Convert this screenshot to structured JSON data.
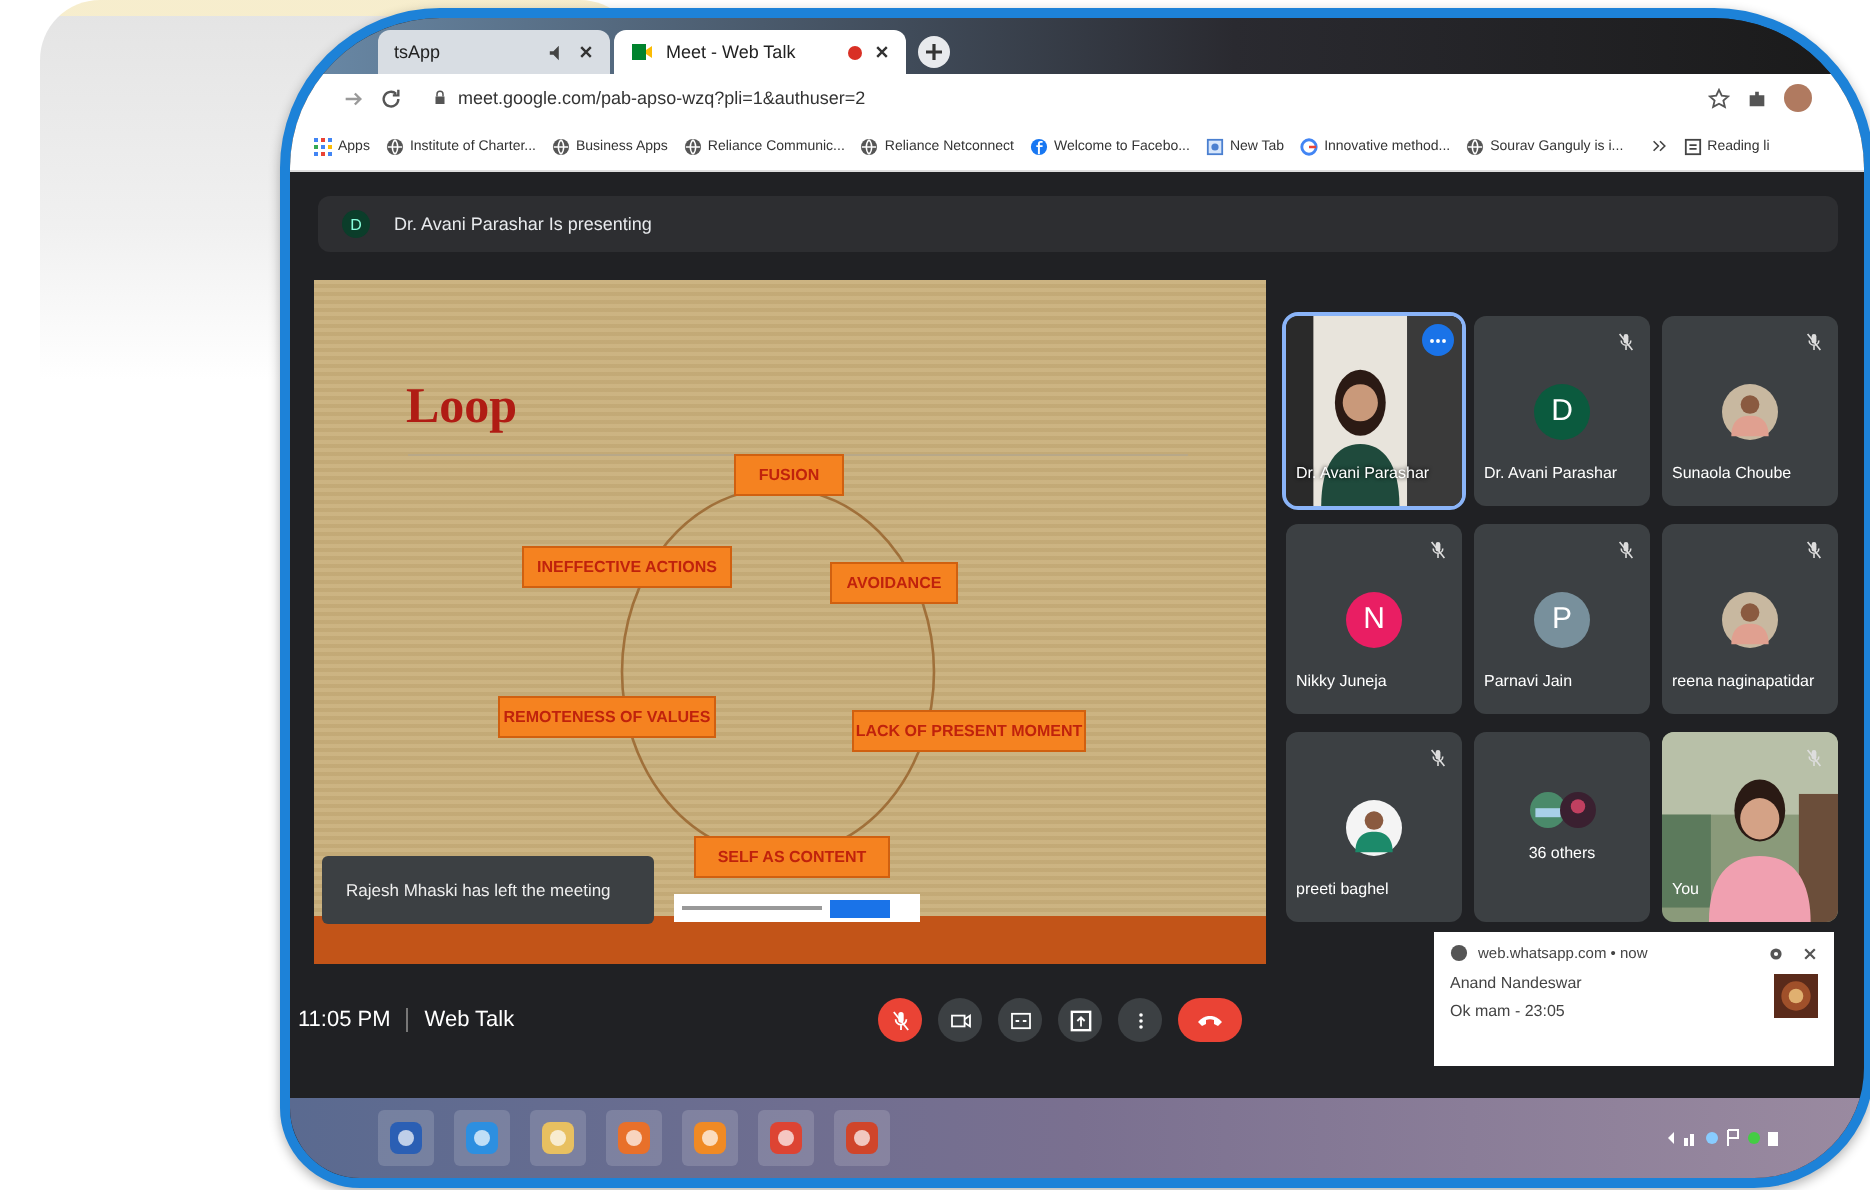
{
  "browser": {
    "tabs": [
      {
        "title": "tsApp",
        "selected": false
      },
      {
        "title": "Meet - Web Talk",
        "selected": true
      }
    ],
    "url": "meet.google.com/pab-apso-wzq?pli=1&authuser=2",
    "bookmarks": [
      {
        "label": "Apps",
        "kind": "apps"
      },
      {
        "label": "Institute of Charter...",
        "kind": "globe"
      },
      {
        "label": "Business Apps",
        "kind": "globe"
      },
      {
        "label": "Reliance Communic...",
        "kind": "globe"
      },
      {
        "label": "Reliance Netconnect",
        "kind": "globe"
      },
      {
        "label": "Welcome to Facebo...",
        "kind": "facebook"
      },
      {
        "label": "New Tab",
        "kind": "page"
      },
      {
        "label": "Innovative method...",
        "kind": "google"
      },
      {
        "label": "Sourav Ganguly is i...",
        "kind": "globe"
      }
    ],
    "reading_list": "Reading li"
  },
  "presenting": {
    "initial": "D",
    "text": "Dr. Avani Parashar Is presenting"
  },
  "slide": {
    "title": "Loop",
    "boxes": [
      "FUSION",
      "INEFFECTIVE ACTIONS",
      "AVOIDANCE",
      "REMOTENESS OF VALUES",
      "LACK OF PRESENT MOMENT",
      "SELF AS CONTENT"
    ]
  },
  "toast": "Rajesh Mhaski has left the meeting",
  "tiles": [
    {
      "name": "Dr. Avani Parashar",
      "kind": "video",
      "muted": false,
      "selected": true
    },
    {
      "name": "Dr. Avani Parashar",
      "kind": "letter",
      "initial": "D",
      "color": "#0b5a3e",
      "muted": true,
      "selected": false
    },
    {
      "name": "Sunaola Choube",
      "muted": true,
      "selected": false
    },
    {
      "name": "Nikky Juneja",
      "kind": "letter",
      "initial": "N",
      "color": "#e91e63",
      "muted": true,
      "selected": false
    },
    {
      "name": "Parnavi Jain",
      "kind": "letter",
      "initial": "P",
      "color": "#78909c",
      "muted": true,
      "selected": false
    },
    {
      "name": "reena naginapatidar",
      "muted": true,
      "selected": false
    },
    {
      "name": "preeti baghel",
      "muted": true,
      "selected": false
    },
    {
      "name": "36 others",
      "kind": "others",
      "muted": false,
      "selected": false
    },
    {
      "name": "You",
      "kind": "self",
      "muted": true,
      "selected": false
    }
  ],
  "bottom_bar": {
    "time": "11:05 PM",
    "meeting": "Web Talk",
    "controls": [
      {
        "kind": "mic",
        "muted": true
      },
      {
        "kind": "camera"
      },
      {
        "kind": "captions"
      },
      {
        "kind": "present"
      },
      {
        "kind": "more"
      },
      {
        "kind": "end"
      }
    ]
  },
  "notification": {
    "source": "web.whatsapp.com • now",
    "sender": "Anand Nandeswar",
    "message": "Ok mam - 23:05"
  }
}
